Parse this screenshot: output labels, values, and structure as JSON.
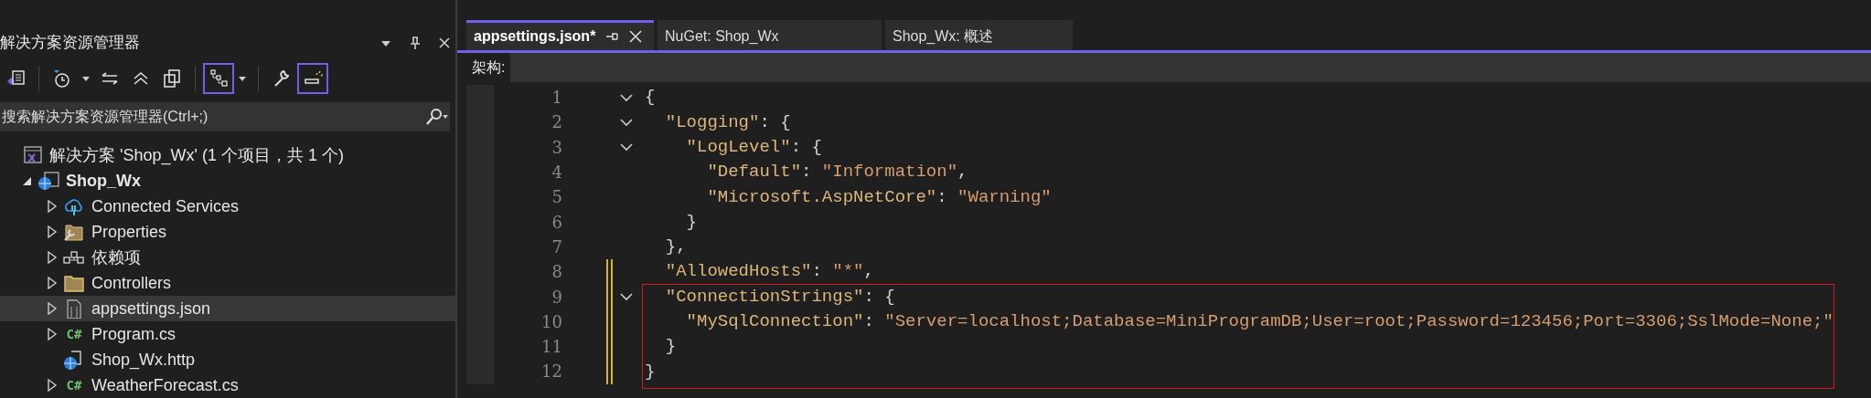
{
  "solution_explorer": {
    "title": "解决方案资源管理器",
    "title_buttons": [
      {
        "kind": "dropdown"
      },
      {
        "kind": "pin"
      },
      {
        "kind": "close"
      }
    ],
    "toolbar": [
      {
        "kind": "switch-views",
        "selected": false,
        "caret": false
      },
      {
        "kind": "history",
        "selected": false,
        "caret": true
      },
      {
        "kind": "sync",
        "selected": false,
        "caret": false
      },
      {
        "kind": "collapse",
        "selected": false,
        "caret": false
      },
      {
        "kind": "copy",
        "selected": false,
        "caret": false
      },
      {
        "kind": "tree-view",
        "selected": true,
        "caret": true
      },
      {
        "kind": "properties",
        "selected": false,
        "caret": false
      },
      {
        "kind": "preview",
        "selected": true,
        "caret": false
      }
    ],
    "search": {
      "placeholder": "搜索解决方案资源管理器(Ctrl+;)"
    },
    "tree": [
      {
        "label": "解决方案 'Shop_Wx' (1 个项目，共 1 个)",
        "kind": "solution",
        "expandable": false,
        "selected": false,
        "bold": false,
        "children": [
          {
            "label": "Shop_Wx",
            "kind": "project",
            "expandable": true,
            "expanded": true,
            "selected": false,
            "bold": true,
            "children": [
              {
                "label": "Connected Services",
                "kind": "cloud",
                "expandable": true,
                "expanded": false,
                "selected": false,
                "bold": false
              },
              {
                "label": "Properties",
                "kind": "properties",
                "expandable": true,
                "expanded": false,
                "selected": false,
                "bold": false
              },
              {
                "label": "依赖项",
                "kind": "dependencies",
                "expandable": true,
                "expanded": false,
                "selected": false,
                "bold": false
              },
              {
                "label": "Controllers",
                "kind": "folder",
                "expandable": true,
                "expanded": false,
                "selected": false,
                "bold": false
              },
              {
                "label": "appsettings.json",
                "kind": "json",
                "expandable": true,
                "expanded": false,
                "selected": true,
                "bold": false
              },
              {
                "label": "Program.cs",
                "kind": "csharp",
                "icon_text": "C#",
                "expandable": true,
                "expanded": false,
                "selected": false,
                "bold": false
              },
              {
                "label": "Shop_Wx.http",
                "kind": "http",
                "expandable": false,
                "selected": false,
                "bold": false
              },
              {
                "label": "WeatherForecast.cs",
                "kind": "csharp",
                "icon_text": "C#",
                "expandable": true,
                "expanded": false,
                "selected": false,
                "bold": false
              }
            ]
          }
        ]
      }
    ]
  },
  "editor": {
    "tabs": [
      {
        "label": "appsettings.json*",
        "selected": true
      },
      {
        "label": "NuGet: Shop_Wx",
        "selected": false
      },
      {
        "label": "Shop_Wx: 概述",
        "selected": false
      }
    ],
    "structure_label": "架构:",
    "lines": [
      {
        "number": "1",
        "fold": true,
        "changed": false,
        "boxed": false,
        "tokens": [
          {
            "kind": "punct",
            "text": "{"
          }
        ]
      },
      {
        "number": "2",
        "fold": true,
        "changed": false,
        "boxed": false,
        "tokens": [
          {
            "kind": "key",
            "text": "  \"Logging\""
          },
          {
            "kind": "punct",
            "text": ": {"
          }
        ]
      },
      {
        "number": "3",
        "fold": true,
        "changed": false,
        "boxed": false,
        "tokens": [
          {
            "kind": "key",
            "text": "    \"LogLevel\""
          },
          {
            "kind": "punct",
            "text": ": {"
          }
        ]
      },
      {
        "number": "4",
        "fold": false,
        "changed": false,
        "boxed": false,
        "tokens": [
          {
            "kind": "key",
            "text": "      \"Default\""
          },
          {
            "kind": "punct",
            "text": ": "
          },
          {
            "kind": "string",
            "text": "\"Information\""
          },
          {
            "kind": "punct",
            "text": ","
          }
        ]
      },
      {
        "number": "5",
        "fold": false,
        "changed": false,
        "boxed": false,
        "tokens": [
          {
            "kind": "key",
            "text": "      \"Microsoft.AspNetCore\""
          },
          {
            "kind": "punct",
            "text": ": "
          },
          {
            "kind": "string",
            "text": "\"Warning\""
          }
        ]
      },
      {
        "number": "6",
        "fold": false,
        "changed": false,
        "boxed": false,
        "tokens": [
          {
            "kind": "punct",
            "text": "    }"
          }
        ]
      },
      {
        "number": "7",
        "fold": false,
        "changed": false,
        "boxed": false,
        "tokens": [
          {
            "kind": "punct",
            "text": "  },"
          }
        ]
      },
      {
        "number": "8",
        "fold": false,
        "changed": true,
        "boxed": false,
        "tokens": [
          {
            "kind": "key",
            "text": "  \"AllowedHosts\""
          },
          {
            "kind": "punct",
            "text": ": "
          },
          {
            "kind": "string",
            "text": "\"*\""
          },
          {
            "kind": "punct",
            "text": ","
          }
        ]
      },
      {
        "number": "9",
        "fold": true,
        "changed": true,
        "boxed": true,
        "tokens": [
          {
            "kind": "key",
            "text": "  \"ConnectionStrings\""
          },
          {
            "kind": "punct",
            "text": ": {"
          }
        ]
      },
      {
        "number": "10",
        "fold": false,
        "changed": true,
        "boxed": true,
        "tokens": [
          {
            "kind": "key",
            "text": "    \"MySqlConnection\""
          },
          {
            "kind": "punct",
            "text": ": "
          },
          {
            "kind": "string",
            "text": "\"Server=localhost;Database=MiniProgramDB;User=root;Password=123456;Port=3306;SslMode=None;\""
          }
        ]
      },
      {
        "number": "11",
        "fold": false,
        "changed": true,
        "boxed": true,
        "tokens": [
          {
            "kind": "punct",
            "text": "  }"
          }
        ]
      },
      {
        "number": "12",
        "fold": false,
        "changed": true,
        "boxed": true,
        "tokens": [
          {
            "kind": "punct",
            "text": "}"
          }
        ]
      }
    ]
  }
}
